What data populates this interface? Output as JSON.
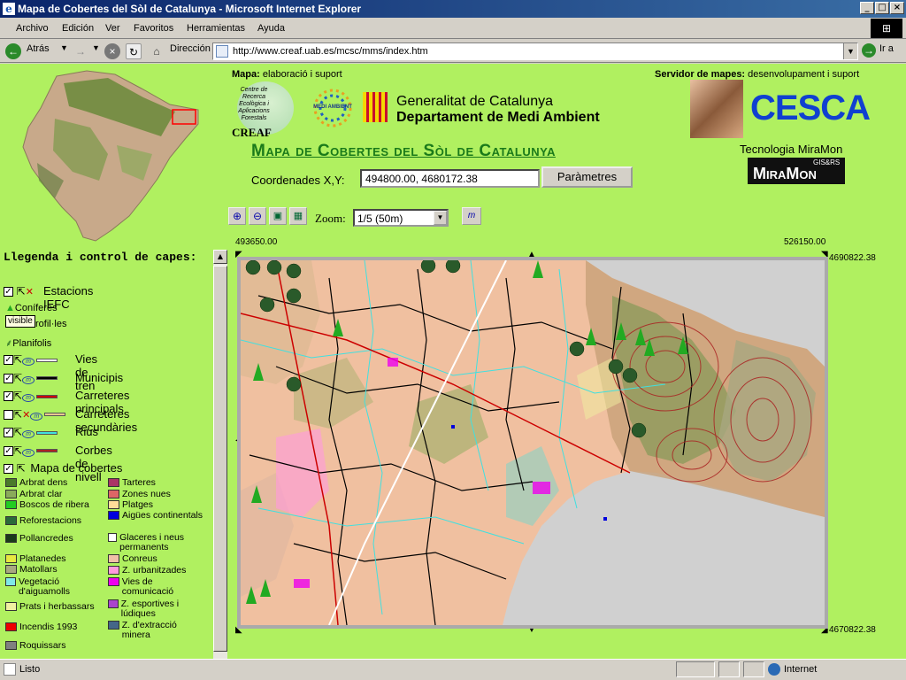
{
  "window": {
    "title": "Mapa de Cobertes del Sòl de Catalunya - Microsoft Internet Explorer"
  },
  "menu": [
    "Archivo",
    "Edición",
    "Ver",
    "Favoritos",
    "Herramientas",
    "Ayuda"
  ],
  "toolbar": {
    "back": "Atrás",
    "address_label": "Dirección",
    "url": "http://www.creaf.uab.es/mcsc/mms/index.htm",
    "go": "Ir a"
  },
  "header": {
    "map_credit_bold": "Mapa:",
    "map_credit": "elaboració i suport",
    "server_credit_bold": "Servidor de mapes:",
    "server_credit": "desenvolupament i suport",
    "creaf_text": "Centre de Recerca Ecològica i Aplicacions Forestals",
    "creaf_name": "CREAF",
    "medi_ambient": "MEDI AMBIENT",
    "gen_line1": "Generalitat de Catalunya",
    "gen_line2": "Departament de Medi Ambient",
    "title": "Mapa de Cobertes del Sòl de Catalunya",
    "cesca": "CESCA",
    "miramon_tech": "Tecnologia MiraMon",
    "miramon": "MiraMon",
    "gis": "GIS&RS"
  },
  "coords": {
    "label": "Coordenades X,Y:",
    "value": "494800.00, 4680172.38",
    "button": "Paràmetres"
  },
  "zoom": {
    "label": "Zoom",
    "value": "1/5 (50m)"
  },
  "map": {
    "x_left": "493650.00",
    "x_right": "526150.00",
    "y_top": "4690822.38",
    "y_bottom": "4670822.38"
  },
  "legend": {
    "title": "Llegenda i control de capes:",
    "estacions": "Estacions IEFC",
    "coniferes": "Coníferes",
    "tooltip": "visible",
    "rofil": "rofil·les",
    "planifolis": "Planifolis",
    "layers": [
      {
        "label": "Vies de tren",
        "color": "#ffffff",
        "checked": true
      },
      {
        "label": "Municipis",
        "color": "#000000",
        "checked": true
      },
      {
        "label": "Carreteres principals",
        "color": "#cc0000",
        "checked": true
      },
      {
        "label": "Carreteres secundàries",
        "color": "#e8c890",
        "checked": false
      },
      {
        "label": "Rius",
        "color": "#40e0e0",
        "checked": true
      },
      {
        "label": "Corbes de nivell",
        "color": "#aa2222",
        "checked": true
      }
    ],
    "mapa_cobertes": "Mapa de cobertes",
    "covers_left": [
      {
        "label": "Arbrat dens",
        "color": "#4a7a2a"
      },
      {
        "label": "Arbrat clar",
        "color": "#8aaa5a"
      },
      {
        "label": "Boscos de ribera",
        "color": "#22cc22"
      },
      {
        "label": "Reforestacions",
        "color": "#2a6a3a"
      },
      {
        "label": "Pollancredes",
        "color": "#1a3a1a"
      },
      {
        "label": "Platanedes",
        "color": "#e8e840"
      },
      {
        "label": "Matollars",
        "color": "#a8a880"
      },
      {
        "label": "Vegetació d'aiguamolls",
        "color": "#80e8e8"
      },
      {
        "label": "Prats i herbassars",
        "color": "#f0f0a0"
      },
      {
        "label": "Incendis 1993",
        "color": "#ee0000"
      },
      {
        "label": "Roquissars",
        "color": "#808080"
      }
    ],
    "covers_right": [
      {
        "label": "Tarteres",
        "color": "#aa3366"
      },
      {
        "label": "Zones nues",
        "color": "#dd6666"
      },
      {
        "label": "Platges",
        "color": "#ffdd99"
      },
      {
        "label": "Aigües continentals",
        "color": "#0000dd"
      },
      {
        "label": "Glaceres i neus permanents",
        "color": "#ffffff"
      },
      {
        "label": "Conreus",
        "color": "#f0c0a8"
      },
      {
        "label": "Z. urbanitzades",
        "color": "#ff99dd"
      },
      {
        "label": "Vies de comunicació",
        "color": "#ee00ee"
      },
      {
        "label": "Z. esportives i lúdiques",
        "color": "#aa44cc"
      },
      {
        "label": "Z. d'extracció minera",
        "color": "#446688"
      }
    ]
  },
  "status": {
    "text": "Listo",
    "zone": "Internet"
  }
}
